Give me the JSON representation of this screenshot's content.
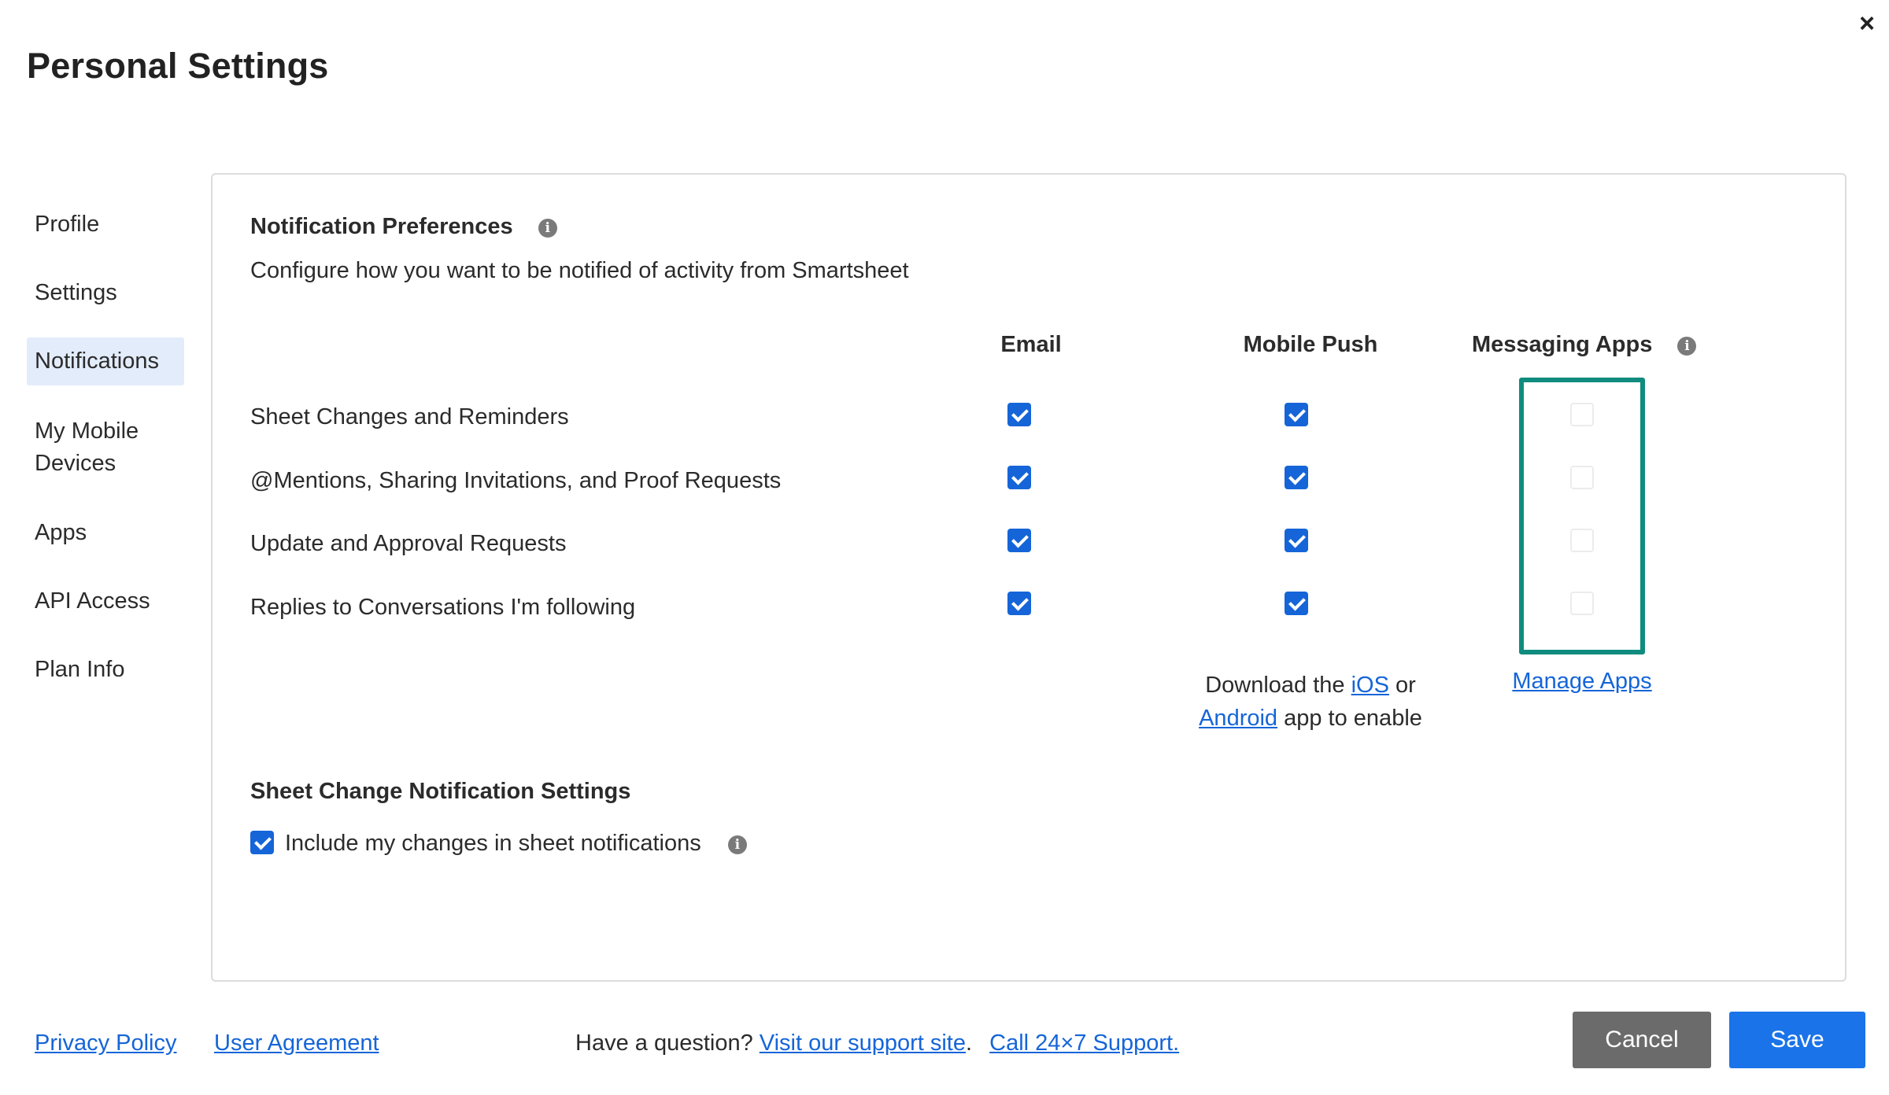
{
  "window": {
    "title": "Personal Settings",
    "close_icon": "×"
  },
  "sidebar": {
    "items": [
      {
        "label": "Profile",
        "active": false
      },
      {
        "label": "Settings",
        "active": false
      },
      {
        "label": "Notifications",
        "active": true
      },
      {
        "label": "My Mobile Devices",
        "active": false
      },
      {
        "label": "Apps",
        "active": false
      },
      {
        "label": "API Access",
        "active": false
      },
      {
        "label": "Plan Info",
        "active": false
      }
    ]
  },
  "notifications": {
    "title": "Notification Preferences",
    "info_icon": "i",
    "description": "Configure how you want to be notified of activity from Smartsheet",
    "columns": [
      "Email",
      "Mobile Push",
      "Messaging Apps"
    ],
    "rows": [
      {
        "label": "Sheet Changes and Reminders",
        "email": true,
        "push": true,
        "messaging": false
      },
      {
        "label": "@Mentions, Sharing Invitations, and Proof Requests",
        "email": true,
        "push": true,
        "messaging": false
      },
      {
        "label": "Update and Approval Requests",
        "email": true,
        "push": true,
        "messaging": false
      },
      {
        "label": "Replies to Conversations I'm following",
        "email": true,
        "push": true,
        "messaging": false
      }
    ],
    "push_hint": {
      "prefix": "Download the ",
      "ios_link": "iOS",
      "middle": " or",
      "android_link": "Android",
      "suffix": " app to enable"
    },
    "manage_apps_link": "Manage Apps"
  },
  "sheet_change": {
    "title": "Sheet Change Notification Settings",
    "include_changes_label": "Include my changes in sheet notifications",
    "include_changes_checked": true
  },
  "footer": {
    "privacy_policy": "Privacy Policy",
    "user_agreement": "User Agreement",
    "question_text": "Have a question? ",
    "support_site_link": "Visit our support site",
    "period": ".",
    "call_support_link": "Call 24×7 Support.",
    "cancel_label": "Cancel",
    "save_label": "Save"
  },
  "colors": {
    "accent": "#1565d8",
    "highlight": "#0f8c7e",
    "cancel_bg": "#6b6b6b",
    "save_bg": "#1a73e8"
  }
}
